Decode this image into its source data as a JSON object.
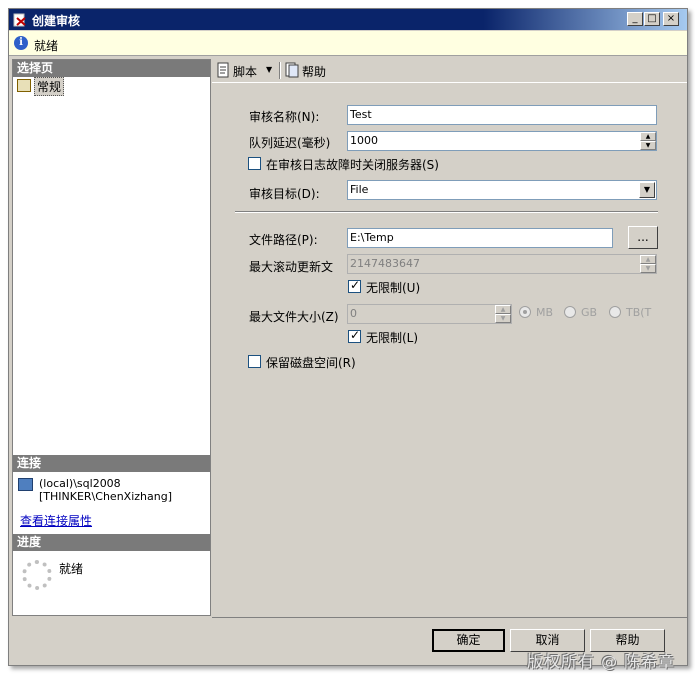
{
  "window": {
    "title": "创建审核",
    "minimize_label": "_",
    "maximize_label": "□",
    "close_label": "×"
  },
  "status": {
    "icon": "info-icon",
    "icon_glyph": "i",
    "text": "就绪"
  },
  "left_pane": {
    "select_page": {
      "header": "选择页",
      "items": [
        {
          "label": "常规",
          "icon": "page-icon"
        }
      ]
    },
    "connection": {
      "header": "连接",
      "server": "(local)\\sql2008",
      "user": "[THINKER\\ChenXizhang]",
      "link": "查看连接属性"
    },
    "progress": {
      "header": "进度",
      "text": "就绪"
    }
  },
  "toolbar": {
    "script_label": "脚本",
    "script_arrow": "▼",
    "help_label": "帮助"
  },
  "form": {
    "audit_name": {
      "label": "审核名称(N):",
      "value": "Test"
    },
    "queue_delay": {
      "label": "队列延迟(毫秒)",
      "value": "1000"
    },
    "shutdown_on_failure": {
      "label": "在审核日志故障时关闭服务器(S)",
      "checked": false
    },
    "audit_target": {
      "label": "审核目标(D):",
      "value": "File"
    },
    "file_path": {
      "label": "文件路径(P):",
      "value": "E:\\Temp",
      "browse_label": "..."
    },
    "max_rollover": {
      "label": "最大滚动更新文",
      "value": "2147483647",
      "unlimited_label": "无限制(U)",
      "unlimited_checked": true
    },
    "max_file_size": {
      "label": "最大文件大小(Z)",
      "value": "0",
      "unit_mb": "MB",
      "unit_gb": "GB",
      "unit_tb": "TB(T",
      "selected_unit": "MB",
      "unlimited_label": "无限制(L)",
      "unlimited_checked": true
    },
    "reserve_disk": {
      "label": "保留磁盘空间(R)",
      "checked": false
    }
  },
  "buttons": {
    "ok": "确定",
    "cancel": "取消",
    "help": "帮助"
  },
  "watermark": "版权所有 @ 陈希章",
  "spin_up": "▲",
  "spin_down": "▼",
  "dropdown_arrow": "▼"
}
